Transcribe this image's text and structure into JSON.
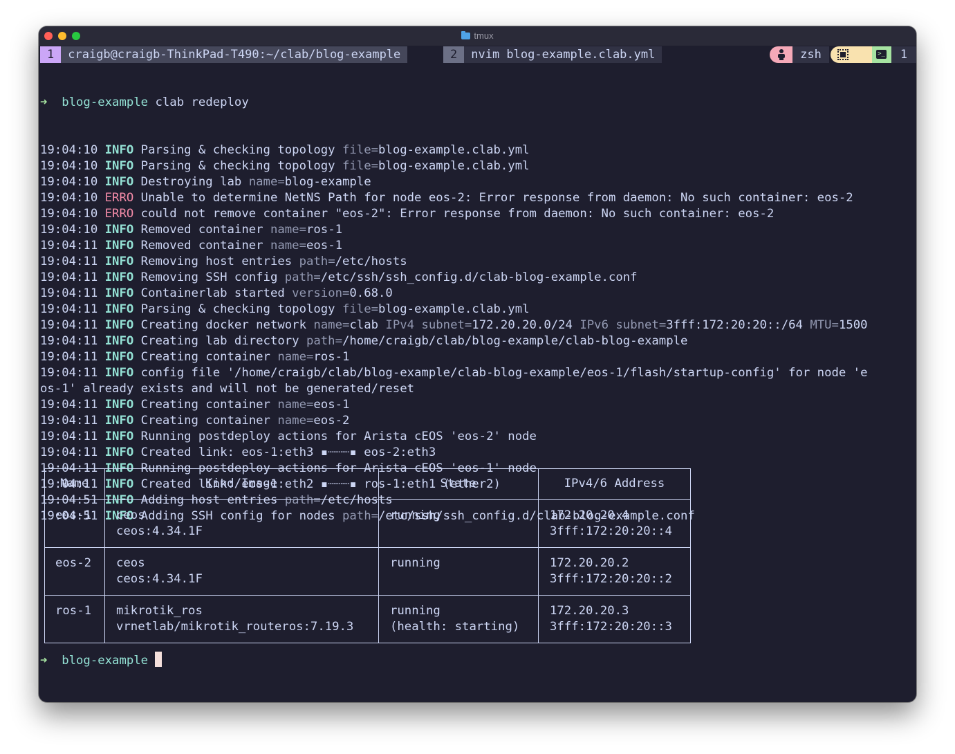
{
  "window": {
    "title": "tmux"
  },
  "tmux": {
    "tabs": [
      {
        "index": "1",
        "title": "craigb@craigb-ThinkPad-T490:~/clab/blog-example",
        "active": true
      },
      {
        "index": "2",
        "title": "nvim blog-example.clab.yml",
        "active": false
      }
    ],
    "status_right": {
      "user_icon": "person-icon",
      "shell": "zsh",
      "cpu_icon": "chip-icon",
      "terminal_icon": "terminal-icon",
      "session_count": "1"
    },
    "colors": {
      "active_tab": "#cba6f7",
      "info": "#94e2d5",
      "error": "#f38ba8",
      "prompt_arrow": "#a6e3a1",
      "background": "#1e1e2e"
    }
  },
  "terminal": {
    "prompt_arrow": "➜",
    "prompt_dir": "blog-example",
    "command": "clab redeploy",
    "log": [
      {
        "time": "19:04:10",
        "level": "INFO",
        "text": "Parsing & checking topology ",
        "key": "file=",
        "value": "blog-example.clab.yml"
      },
      {
        "time": "19:04:10",
        "level": "INFO",
        "text": "Parsing & checking topology ",
        "key": "file=",
        "value": "blog-example.clab.yml"
      },
      {
        "time": "19:04:10",
        "level": "INFO",
        "text": "Destroying lab ",
        "key": "name=",
        "value": "blog-example"
      },
      {
        "time": "19:04:10",
        "level": "ERRO",
        "text": "Unable to determine NetNS Path for node eos-2: Error response from daemon: No such container: eos-2",
        "key": "",
        "value": ""
      },
      {
        "time": "19:04:10",
        "level": "ERRO",
        "text": "could not remove container \"eos-2\": Error response from daemon: No such container: eos-2",
        "key": "",
        "value": ""
      },
      {
        "time": "19:04:10",
        "level": "INFO",
        "text": "Removed container ",
        "key": "name=",
        "value": "ros-1"
      },
      {
        "time": "19:04:11",
        "level": "INFO",
        "text": "Removed container ",
        "key": "name=",
        "value": "eos-1"
      },
      {
        "time": "19:04:11",
        "level": "INFO",
        "text": "Removing host entries ",
        "key": "path=",
        "value": "/etc/hosts"
      },
      {
        "time": "19:04:11",
        "level": "INFO",
        "text": "Removing SSH config ",
        "key": "path=",
        "value": "/etc/ssh/ssh_config.d/clab-blog-example.conf"
      },
      {
        "time": "19:04:11",
        "level": "INFO",
        "text": "Containerlab started ",
        "key": "version=",
        "value": "0.68.0"
      },
      {
        "time": "19:04:11",
        "level": "INFO",
        "text": "Parsing & checking topology ",
        "key": "file=",
        "value": "blog-example.clab.yml"
      },
      {
        "time": "19:04:11",
        "level": "INFO",
        "text": "Creating docker network ",
        "key": "name=",
        "value": "clab",
        "key2": " IPv4 subnet=",
        "value2": "172.20.20.0/24",
        "key3": " IPv6 subnet=",
        "value3": "3fff:172:20:20::/64",
        "key4": " MTU=",
        "value4": "1500"
      },
      {
        "time": "19:04:11",
        "level": "INFO",
        "text": "Creating lab directory ",
        "key": "path=",
        "value": "/home/craigb/clab/blog-example/clab-blog-example"
      },
      {
        "time": "19:04:11",
        "level": "INFO",
        "text": "Creating container ",
        "key": "name=",
        "value": "ros-1"
      },
      {
        "time": "19:04:11",
        "level": "INFO",
        "text": "config file '/home/craigb/clab/blog-example/clab-blog-example/eos-1/flash/startup-config' for node 'e",
        "key": "",
        "value": ""
      },
      {
        "continuation": "os-1' already exists and will not be generated/reset"
      },
      {
        "time": "19:04:11",
        "level": "INFO",
        "text": "Creating container ",
        "key": "name=",
        "value": "eos-1"
      },
      {
        "time": "19:04:11",
        "level": "INFO",
        "text": "Creating container ",
        "key": "name=",
        "value": "eos-2"
      },
      {
        "time": "19:04:11",
        "level": "INFO",
        "text": "Running postdeploy actions for Arista cEOS 'eos-2' node",
        "key": "",
        "value": ""
      },
      {
        "time": "19:04:11",
        "level": "INFO",
        "text": "Created link: eos-1:eth3 ▪┈┈┈▪ eos-2:eth3",
        "key": "",
        "value": ""
      },
      {
        "time": "19:04:11",
        "level": "INFO",
        "text": "Running postdeploy actions for Arista cEOS 'eos-1' node",
        "key": "",
        "value": ""
      },
      {
        "time": "19:04:11",
        "level": "INFO",
        "text": "Created link: eos-1:eth2 ▪┈┈┈▪ ros-1:eth1 (ether2)",
        "key": "",
        "value": ""
      },
      {
        "time": "19:04:51",
        "level": "INFO",
        "text": "Adding host entries ",
        "key": "path=",
        "value": "/etc/hosts"
      },
      {
        "time": "19:04:51",
        "level": "INFO",
        "text": "Adding SSH config for nodes ",
        "key": "path=",
        "value": "/etc/ssh/ssh_config.d/clab-blog-example.conf"
      }
    ],
    "table": {
      "headers": [
        "Name",
        "Kind/Image",
        "State",
        "IPv4/6 Address"
      ],
      "rows": [
        {
          "name": "eos-1",
          "kind": "ceos",
          "image": "ceos:4.34.1F",
          "state": "running",
          "state2": "",
          "ipv4": "172.20.20.4",
          "ipv6": "3fff:172:20:20::4"
        },
        {
          "name": "eos-2",
          "kind": "ceos",
          "image": "ceos:4.34.1F",
          "state": "running",
          "state2": "",
          "ipv4": "172.20.20.2",
          "ipv6": "3fff:172:20:20::2"
        },
        {
          "name": "ros-1",
          "kind": "mikrotik_ros",
          "image": "vrnetlab/mikrotik_routeros:7.19.3",
          "state": "running",
          "state2": "(health: starting)",
          "ipv4": "172.20.20.3",
          "ipv6": "3fff:172:20:20::3"
        }
      ]
    },
    "final_prompt_dir": "blog-example"
  }
}
